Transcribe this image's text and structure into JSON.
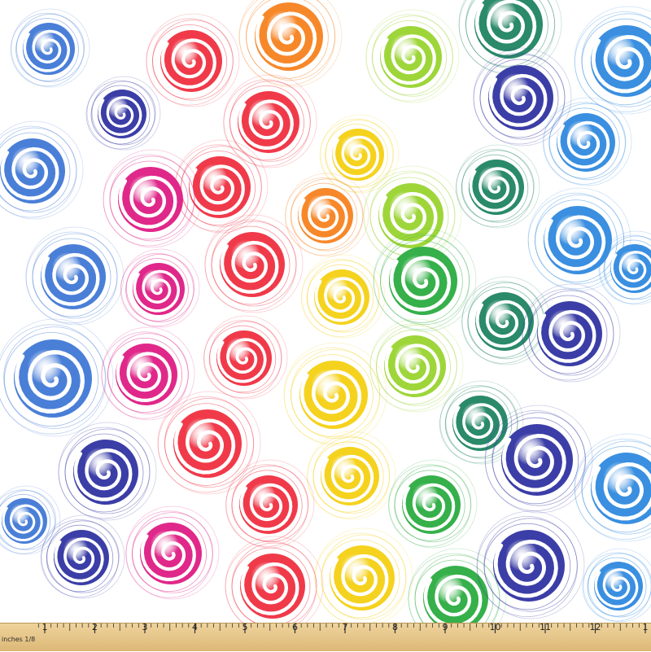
{
  "fabric": {
    "pattern": "rainbow swirl circles on white",
    "palette": [
      "#4a7fd8",
      "#3b3ea6",
      "#7a38b8",
      "#e0288a",
      "#f03a4a",
      "#f7882a",
      "#f5d21e",
      "#9ed63a",
      "#36b04a",
      "#2a8a6a",
      "#3a8fe0"
    ]
  },
  "ruler": {
    "caption": "inches 1/8",
    "numbers": [
      "1",
      "2",
      "3",
      "4",
      "5",
      "6",
      "7",
      "8",
      "9",
      "10",
      "11",
      "12",
      "1"
    ]
  }
}
